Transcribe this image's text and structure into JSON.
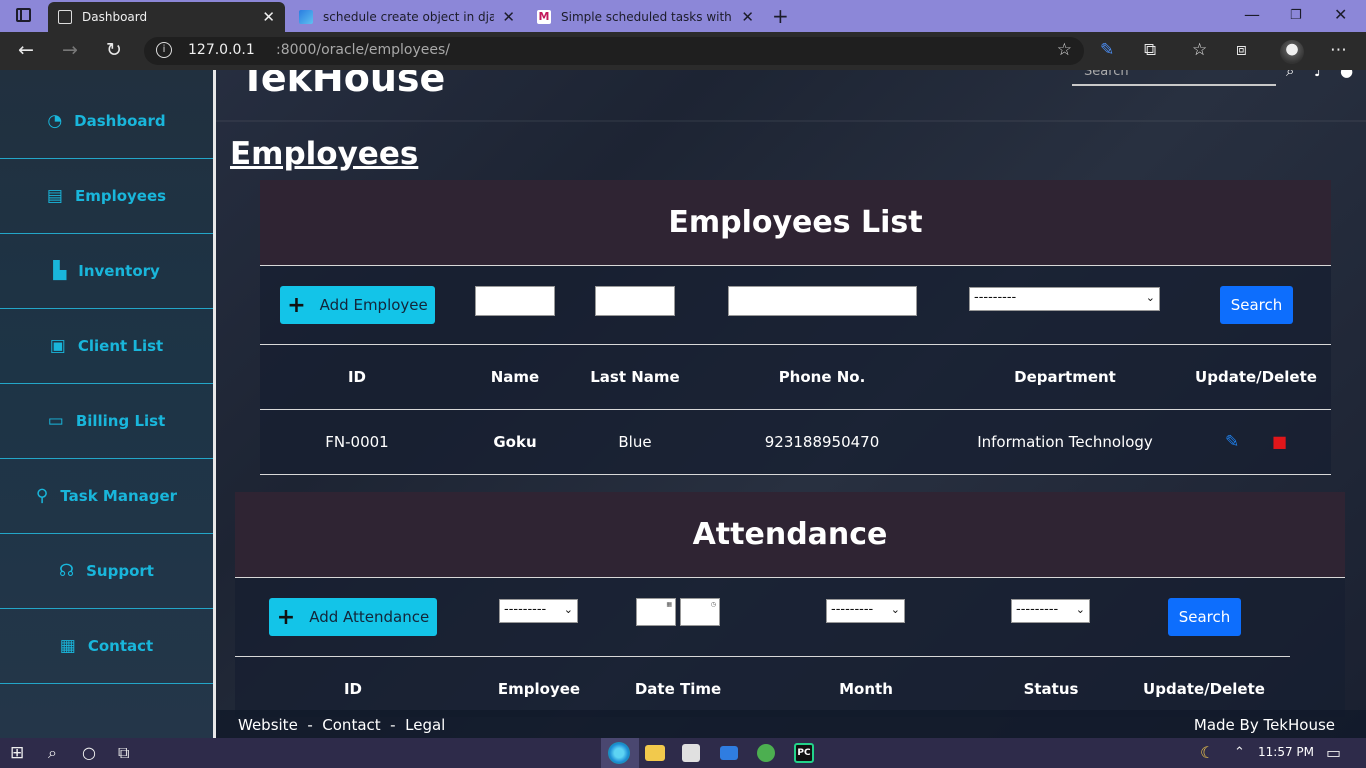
{
  "browser": {
    "tabs": [
      {
        "title": "Dashboard",
        "icon": "page-icon",
        "active": true
      },
      {
        "title": "schedule create object in django",
        "icon": "bing-icon",
        "active": false
      },
      {
        "title": "Simple scheduled tasks with Djar",
        "icon": "gmail-icon",
        "active": false
      }
    ],
    "url_host": "127.0.0.1",
    "url_path": ":8000/oracle/employees/"
  },
  "sidebar": {
    "items": [
      {
        "label": "Dashboard",
        "icon": "dashboard-gauge-icon"
      },
      {
        "label": "Employees",
        "icon": "id-card-icon"
      },
      {
        "label": "Inventory",
        "icon": "dolly-icon"
      },
      {
        "label": "Client List",
        "icon": "contact-book-icon"
      },
      {
        "label": "Billing List",
        "icon": "money-bill-icon"
      },
      {
        "label": "Task Manager",
        "icon": "thumbtack-icon"
      },
      {
        "label": "Support",
        "icon": "headset-icon"
      },
      {
        "label": "Contact",
        "icon": "address-card-icon"
      }
    ]
  },
  "header": {
    "brand": "TekHouse",
    "search_placeholder": "Search"
  },
  "page_title": "Employees",
  "employees_panel": {
    "heading": "Employees List",
    "add_button": "Add Employee",
    "department_select": "---------",
    "search_button": "Search",
    "columns": [
      "ID",
      "Name",
      "Last Name",
      "Phone No.",
      "Department",
      "Update/Delete"
    ],
    "rows": [
      {
        "id": "FN-0001",
        "name": "Goku",
        "last_name": "Blue",
        "phone": "923188950470",
        "department": "Information Technology"
      }
    ]
  },
  "attendance_panel": {
    "heading": "Attendance",
    "add_button": "Add Attendance",
    "employee_select": "---------",
    "month_select": "---------",
    "status_select": "---------",
    "search_button": "Search",
    "columns": [
      "ID",
      "Employee",
      "Date Time",
      "Month",
      "Status",
      "Update/Delete"
    ]
  },
  "footer": {
    "links": "Website  -  Contact  -  Legal",
    "credit": "Made By TekHouse"
  },
  "taskbar": {
    "time": "11:57 PM"
  },
  "colors": {
    "accent_cyan": "#13c4e8",
    "primary_blue": "#0d6efd",
    "panel_header": "#2f2433",
    "delete_red": "#e0161a",
    "browser_frame": "#8c87d8"
  }
}
